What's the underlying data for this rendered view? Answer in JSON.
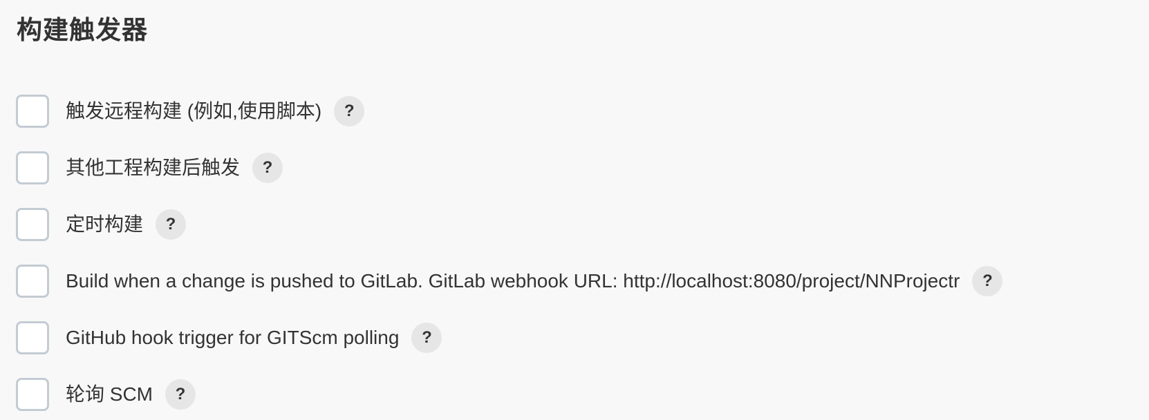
{
  "section": {
    "title": "构建触发器"
  },
  "triggers": [
    {
      "label": "触发远程构建 (例如,使用脚本)",
      "checked": false,
      "help": "?"
    },
    {
      "label": "其他工程构建后触发",
      "checked": false,
      "help": "?"
    },
    {
      "label": "定时构建",
      "checked": false,
      "help": "?"
    },
    {
      "label": "Build when a change is pushed to GitLab. GitLab webhook URL: http://localhost:8080/project/NNProjectr",
      "checked": false,
      "help": "?"
    },
    {
      "label": "GitHub hook trigger for GITScm polling",
      "checked": false,
      "help": "?"
    },
    {
      "label": "轮询 SCM",
      "checked": false,
      "help": "?"
    }
  ],
  "colors": {
    "background": "#f8f8f8",
    "text": "#333333",
    "checkbox_border": "#c3cbd3",
    "help_background": "#e6e6e6"
  }
}
